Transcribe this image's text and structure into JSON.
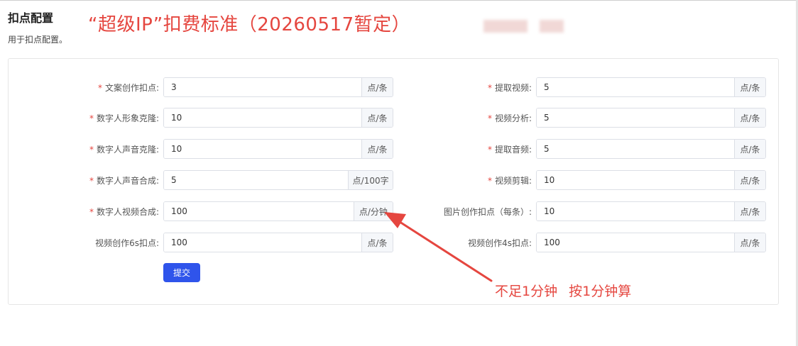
{
  "header": {
    "title": "扣点配置",
    "subtitle": "用于扣点配置。"
  },
  "annotations": {
    "title": "“超级IP”扣费标准（20260517暂定）",
    "note": "不足1分钟 按1分钟算",
    "color": "#e5463f"
  },
  "form": {
    "left": [
      {
        "label": "文案创作扣点:",
        "required": true,
        "value": "3",
        "unit": "点/条"
      },
      {
        "label": "数字人形象克隆:",
        "required": true,
        "value": "10",
        "unit": "点/条"
      },
      {
        "label": "数字人声音克隆:",
        "required": true,
        "value": "10",
        "unit": "点/条"
      },
      {
        "label": "数字人声音合成:",
        "required": true,
        "value": "5",
        "unit": "点/100字"
      },
      {
        "label": "数字人视频合成:",
        "required": true,
        "value": "100",
        "unit": "点/分钟"
      },
      {
        "label": "视频创作6s扣点:",
        "required": false,
        "value": "100",
        "unit": "点/条"
      }
    ],
    "right": [
      {
        "label": "提取视频:",
        "required": true,
        "value": "5",
        "unit": "点/条"
      },
      {
        "label": "视频分析:",
        "required": true,
        "value": "5",
        "unit": "点/条"
      },
      {
        "label": "提取音频:",
        "required": true,
        "value": "5",
        "unit": "点/条"
      },
      {
        "label": "视频剪辑:",
        "required": true,
        "value": "10",
        "unit": "点/条"
      },
      {
        "label": "图片创作扣点（每条）:",
        "required": false,
        "value": "10",
        "unit": "点/条"
      },
      {
        "label": "视频创作4s扣点:",
        "required": false,
        "value": "100",
        "unit": "点/条"
      }
    ],
    "submit_label": "提交",
    "accent": "#2f54eb"
  }
}
